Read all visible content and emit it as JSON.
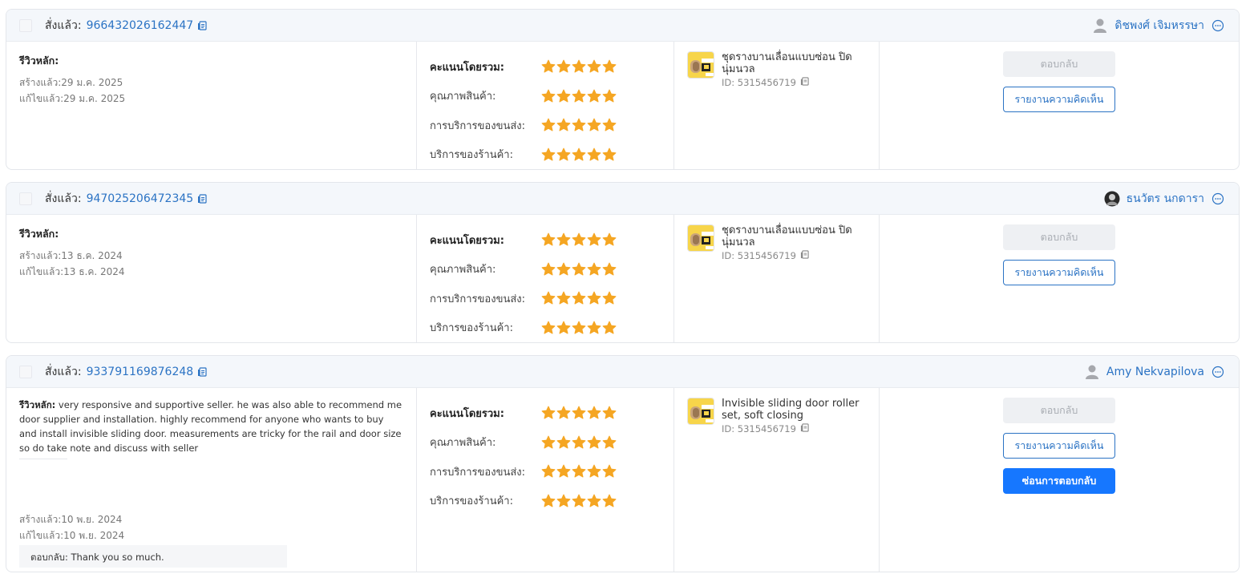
{
  "reviews": [
    {
      "ordered_label": "สั่งแล้ว:",
      "order_no": "966432026162447",
      "buyer": "ดิชพงศ์ เจิมหรรษา",
      "review_label": "รีวิวหลัก:",
      "review_text": "",
      "created": "สร้างแล้ว:29 ม.ค. 2025",
      "edited": "แก้ไขแล้ว:29 ม.ค. 2025",
      "reply": "",
      "ratings": [
        {
          "label": "คะแนนโดยรวม:",
          "stars": 5
        },
        {
          "label": "คุณภาพสินค้า:",
          "stars": 5
        },
        {
          "label": "การบริการของขนส่ง:",
          "stars": 5
        },
        {
          "label": "บริการของร้านค้า:",
          "stars": 5
        }
      ],
      "product_name": "ชุดรางบานเลื่อนแบบซ่อน ปิดนุ่มนวล",
      "product_id": "ID: 5315456719",
      "reply_button": "ตอบกลับ",
      "report_button": "รายงานความคิดเห็น",
      "hide_reply_button": ""
    },
    {
      "ordered_label": "สั่งแล้ว:",
      "order_no": "947025206472345",
      "buyer": "ธนวัตร นกดารา",
      "review_label": "รีวิวหลัก:",
      "review_text": "",
      "created": "สร้างแล้ว:13 ธ.ค. 2024",
      "edited": "แก้ไขแล้ว:13 ธ.ค. 2024",
      "reply": "",
      "ratings": [
        {
          "label": "คะแนนโดยรวม:",
          "stars": 5
        },
        {
          "label": "คุณภาพสินค้า:",
          "stars": 5
        },
        {
          "label": "การบริการของขนส่ง:",
          "stars": 5
        },
        {
          "label": "บริการของร้านค้า:",
          "stars": 5
        }
      ],
      "product_name": "ชุดรางบานเลื่อนแบบซ่อน ปิดนุ่มนวล",
      "product_id": "ID: 5315456719",
      "reply_button": "ตอบกลับ",
      "report_button": "รายงานความคิดเห็น",
      "hide_reply_button": ""
    },
    {
      "ordered_label": "สั่งแล้ว:",
      "order_no": "933791169876248",
      "buyer": "Amy Nekvapilova",
      "review_label": "รีวิวหลัก:",
      "review_text": " very responsive and supportive seller. he was also able to recommend me door supplier and installation. highly recommend for anyone who wants to buy and install invisible sliding door. measurements are tricky for the rail and door size so do take note and discuss with seller",
      "created": "สร้างแล้ว:10 พ.ย. 2024",
      "edited": "แก้ไขแล้ว:10 พ.ย. 2024",
      "reply": "ตอบกลับ: Thank you so much.",
      "ratings": [
        {
          "label": "คะแนนโดยรวม:",
          "stars": 5
        },
        {
          "label": "คุณภาพสินค้า:",
          "stars": 5
        },
        {
          "label": "การบริการของขนส่ง:",
          "stars": 5
        },
        {
          "label": "บริการของร้านค้า:",
          "stars": 5
        }
      ],
      "product_name": "Invisible sliding door roller set, soft closing",
      "product_id": "ID: 5315456719",
      "reply_button": "ตอบกลับ",
      "report_button": "รายงานความคิดเห็น",
      "hide_reply_button": "ซ่อนการตอบกลับ"
    }
  ],
  "colors": {
    "link": "#2b73c4",
    "star": "#f5a623",
    "primary": "#1677ff",
    "header_bg": "#f4f7fb"
  },
  "icons": {
    "copy": "copy-icon",
    "avatar": "user-avatar-icon",
    "chat": "chat-icon",
    "star": "star-icon",
    "product_thumb": "door-roller-product-image"
  }
}
